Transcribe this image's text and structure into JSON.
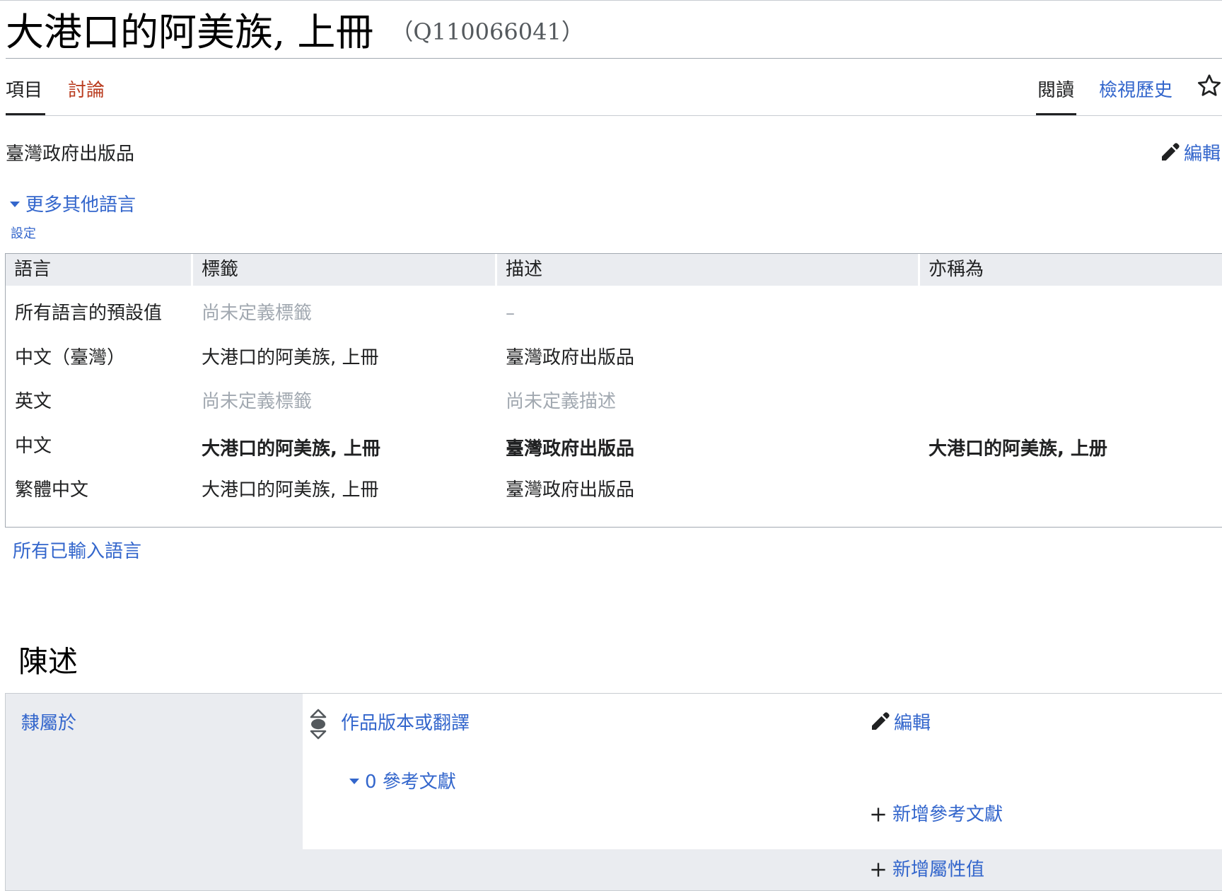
{
  "title": {
    "label": "大港口的阿美族, 上冊",
    "id": "（Q110066041）"
  },
  "tabs": {
    "item": "項目",
    "talk": "討論",
    "read": "閱讀",
    "history": "檢視歷史"
  },
  "description": "臺灣政府出版品",
  "edit_label": "編輯",
  "more_languages": "更多其他語言",
  "settings": "設定",
  "language_table": {
    "headers": [
      "語言",
      "標籤",
      "描述",
      "亦稱為"
    ],
    "rows": [
      {
        "language": "所有語言的預設值",
        "label": "尚未定義標籤",
        "description": "–",
        "aliases": ""
      },
      {
        "language": "中文（臺灣）",
        "label": "大港口的阿美族, 上冊",
        "description": "臺灣政府出版品",
        "aliases": ""
      },
      {
        "language": "英文",
        "label": "尚未定義標籤",
        "description": "尚未定義描述",
        "aliases": ""
      },
      {
        "language": "中文",
        "label": "大港口的阿美族, 上冊",
        "description": "臺灣政府出版品",
        "aliases": "大港口的阿美族, 上册"
      },
      {
        "language": "繁體中文",
        "label": "大港口的阿美族, 上冊",
        "description": "臺灣政府出版品",
        "aliases": ""
      }
    ]
  },
  "all_entered_languages": "所有已輸入語言",
  "statements": {
    "heading": "陳述",
    "property": "隸屬於",
    "value": "作品版本或翻譯",
    "edit": "編輯",
    "references": "0 參考文獻",
    "add_reference": "新增參考文獻",
    "add_value": "新增屬性值"
  },
  "colors": {
    "link": "#3366cc",
    "talk_link": "#ba3d20",
    "muted": "#a2a9b1",
    "table_header": "#eaecf0"
  },
  "icons": [
    "star-icon",
    "pencil-icon",
    "caret-down-icon",
    "rank-icon",
    "plus-icon"
  ]
}
